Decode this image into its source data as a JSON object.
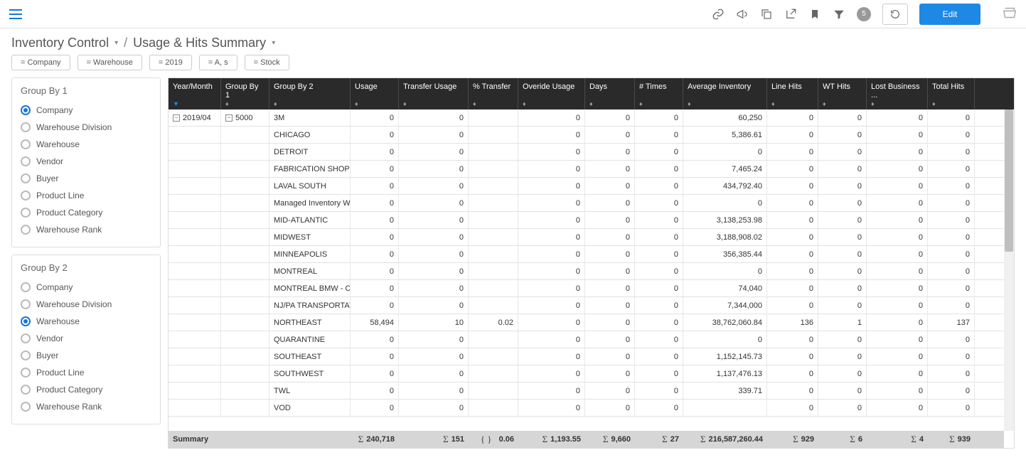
{
  "toolbar": {
    "badge_count": "5",
    "edit_label": "Edit"
  },
  "breadcrumb": {
    "parent": "Inventory Control",
    "current": "Usage & Hits Summary"
  },
  "chips": [
    "= Company",
    "= Warehouse",
    "= 2019",
    "= A, s",
    "= Stock"
  ],
  "group1": {
    "title": "Group By 1",
    "options": [
      "Company",
      "Warehouse Division",
      "Warehouse",
      "Vendor",
      "Buyer",
      "Product Line",
      "Product Category",
      "Warehouse Rank"
    ],
    "selected": "Company"
  },
  "group2": {
    "title": "Group By 2",
    "options": [
      "Company",
      "Warehouse Division",
      "Warehouse",
      "Vendor",
      "Buyer",
      "Product Line",
      "Product Category",
      "Warehouse Rank"
    ],
    "selected": "Warehouse"
  },
  "columns": [
    "Year/Month",
    "Group By 1",
    "Group By 2",
    "Usage",
    "Transfer Usage",
    "% Transfer",
    "Overide Usage",
    "Days",
    "# Times",
    "Average Inventory",
    "Line Hits",
    "WT Hits",
    "Lost Business ...",
    "Total Hits"
  ],
  "ym_value": "2019/04",
  "g1_value": "5000",
  "rows": [
    {
      "g2": "3M",
      "usage": "0",
      "tu": "0",
      "pct": "",
      "ov": "0",
      "days": "0",
      "times": "0",
      "avg": "60,250",
      "lh": "0",
      "wt": "0",
      "lb": "0",
      "th": "0"
    },
    {
      "g2": "CHICAGO",
      "usage": "0",
      "tu": "0",
      "pct": "",
      "ov": "0",
      "days": "0",
      "times": "0",
      "avg": "5,386.61",
      "lh": "0",
      "wt": "0",
      "lb": "0",
      "th": "0"
    },
    {
      "g2": "DETROIT",
      "usage": "0",
      "tu": "0",
      "pct": "",
      "ov": "0",
      "days": "0",
      "times": "0",
      "avg": "0",
      "lh": "0",
      "wt": "0",
      "lb": "0",
      "th": "0"
    },
    {
      "g2": "FABRICATION SHOP",
      "usage": "0",
      "tu": "0",
      "pct": "",
      "ov": "0",
      "days": "0",
      "times": "0",
      "avg": "7,465.24",
      "lh": "0",
      "wt": "0",
      "lb": "0",
      "th": "0"
    },
    {
      "g2": "LAVAL SOUTH",
      "usage": "0",
      "tu": "0",
      "pct": "",
      "ov": "0",
      "days": "0",
      "times": "0",
      "avg": "434,792.40",
      "lh": "0",
      "wt": "0",
      "lb": "0",
      "th": "0"
    },
    {
      "g2": "Managed Inventory WH",
      "usage": "0",
      "tu": "0",
      "pct": "",
      "ov": "0",
      "days": "0",
      "times": "0",
      "avg": "0",
      "lh": "0",
      "wt": "0",
      "lb": "0",
      "th": "0"
    },
    {
      "g2": "MID-ATLANTIC",
      "usage": "0",
      "tu": "0",
      "pct": "",
      "ov": "0",
      "days": "0",
      "times": "0",
      "avg": "3,138,253.98",
      "lh": "0",
      "wt": "0",
      "lb": "0",
      "th": "0"
    },
    {
      "g2": "MIDWEST",
      "usage": "0",
      "tu": "0",
      "pct": "",
      "ov": "0",
      "days": "0",
      "times": "0",
      "avg": "3,188,908.02",
      "lh": "0",
      "wt": "0",
      "lb": "0",
      "th": "0"
    },
    {
      "g2": "MINNEAPOLIS",
      "usage": "0",
      "tu": "0",
      "pct": "",
      "ov": "0",
      "days": "0",
      "times": "0",
      "avg": "356,385.44",
      "lh": "0",
      "wt": "0",
      "lb": "0",
      "th": "0"
    },
    {
      "g2": "MONTREAL",
      "usage": "0",
      "tu": "0",
      "pct": "",
      "ov": "0",
      "days": "0",
      "times": "0",
      "avg": "0",
      "lh": "0",
      "wt": "0",
      "lb": "0",
      "th": "0"
    },
    {
      "g2": "MONTREAL BMW - CON…",
      "usage": "0",
      "tu": "0",
      "pct": "",
      "ov": "0",
      "days": "0",
      "times": "0",
      "avg": "74,040",
      "lh": "0",
      "wt": "0",
      "lb": "0",
      "th": "0"
    },
    {
      "g2": "NJ/PA TRANSPORTATI…",
      "usage": "0",
      "tu": "0",
      "pct": "",
      "ov": "0",
      "days": "0",
      "times": "0",
      "avg": "7,344,000",
      "lh": "0",
      "wt": "0",
      "lb": "0",
      "th": "0"
    },
    {
      "g2": "NORTHEAST",
      "usage": "58,494",
      "tu": "10",
      "pct": "0.02",
      "ov": "0",
      "days": "0",
      "times": "0",
      "avg": "38,762,060.84",
      "lh": "136",
      "wt": "1",
      "lb": "0",
      "th": "137"
    },
    {
      "g2": "QUARANTINE",
      "usage": "0",
      "tu": "0",
      "pct": "",
      "ov": "0",
      "days": "0",
      "times": "0",
      "avg": "0",
      "lh": "0",
      "wt": "0",
      "lb": "0",
      "th": "0"
    },
    {
      "g2": "SOUTHEAST",
      "usage": "0",
      "tu": "0",
      "pct": "",
      "ov": "0",
      "days": "0",
      "times": "0",
      "avg": "1,152,145.73",
      "lh": "0",
      "wt": "0",
      "lb": "0",
      "th": "0"
    },
    {
      "g2": "SOUTHWEST",
      "usage": "0",
      "tu": "0",
      "pct": "",
      "ov": "0",
      "days": "0",
      "times": "0",
      "avg": "1,137,476.13",
      "lh": "0",
      "wt": "0",
      "lb": "0",
      "th": "0"
    },
    {
      "g2": "TWL",
      "usage": "0",
      "tu": "0",
      "pct": "",
      "ov": "0",
      "days": "0",
      "times": "0",
      "avg": "339.71",
      "lh": "0",
      "wt": "0",
      "lb": "0",
      "th": "0"
    },
    {
      "g2": "VOD",
      "usage": "0",
      "tu": "0",
      "pct": "",
      "ov": "0",
      "days": "0",
      "times": "0",
      "avg": "",
      "lh": "0",
      "wt": "0",
      "lb": "0",
      "th": "0"
    }
  ],
  "summary": {
    "label": "Summary",
    "usage": "240,718",
    "tu": "151",
    "pct_symbol": "{ }",
    "pct": "0.06",
    "ov": "1,193.55",
    "days": "9,660",
    "times": "27",
    "avg": "216,587,260.44",
    "lh": "929",
    "wt": "6",
    "lb": "4",
    "th": "939"
  }
}
